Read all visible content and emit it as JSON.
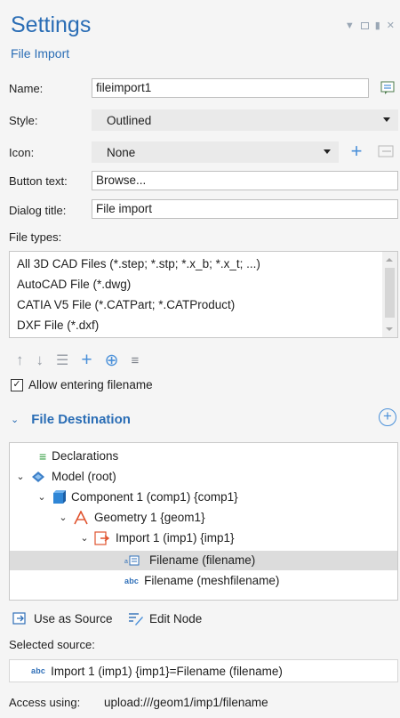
{
  "header": {
    "title": "Settings",
    "subtitle": "File Import"
  },
  "form": {
    "name_label": "Name:",
    "name_value": "fileimport1",
    "style_label": "Style:",
    "style_value": "Outlined",
    "icon_label": "Icon:",
    "icon_value": "None",
    "button_text_label": "Button text:",
    "button_text_value": "Browse...",
    "dialog_title_label": "Dialog title:",
    "dialog_title_value": "File import",
    "file_types_label": "File types:"
  },
  "file_types": [
    "All 3D CAD Files (*.step; *.stp; *.x_b; *.x_t; ...)",
    "AutoCAD File (*.dwg)",
    "CATIA V5 File (*.CATPart; *.CATProduct)",
    "DXF File (*.dxf)"
  ],
  "allow_entering": {
    "label": "Allow entering filename",
    "checked": true
  },
  "destination": {
    "title": "File Destination",
    "tree": [
      {
        "label": "Declarations",
        "icon": "declarations-icon"
      },
      {
        "label": "Model (root)",
        "icon": "model-icon"
      },
      {
        "label": "Component 1 (comp1) {comp1}",
        "icon": "component-icon"
      },
      {
        "label": "Geometry 1 {geom1}",
        "icon": "geometry-icon"
      },
      {
        "label": "Import 1 (imp1) {imp1}",
        "icon": "import-icon"
      },
      {
        "label": "Filename (filename)",
        "icon": "file-node-icon"
      },
      {
        "label": "Filename (meshfilename)",
        "icon": "abc-icon"
      }
    ],
    "use_as_source": "Use as Source",
    "edit_node": "Edit Node",
    "selected_source_label": "Selected source:",
    "selected_source_value": "Import 1 (imp1) {imp1}=Filename (filename)",
    "access_label": "Access using:",
    "access_value": "upload:///geom1/imp1/filename",
    "abc_text": "abc"
  },
  "colors": {
    "accent": "#2a6db5",
    "icon_blue": "#4a90d9",
    "selected_row": "#dcdcdc"
  }
}
